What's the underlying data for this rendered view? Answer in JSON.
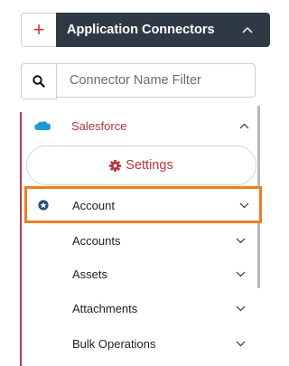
{
  "header": {
    "add_symbol": "+",
    "title": "Application Connectors",
    "collapse_icon": "chevron-up-icon"
  },
  "search": {
    "icon": "search-icon",
    "placeholder": "Connector Name Filter",
    "value": ""
  },
  "tree": {
    "connector": {
      "label": "Salesforce",
      "icon": "salesforce-cloud-icon",
      "expanded": true
    },
    "settings_button": {
      "label": "Settings",
      "icon": "gear-icon"
    },
    "selected_item": {
      "label": "Account",
      "icon": "entity-icon",
      "highlight_color": "#f07c22"
    },
    "sub_items": [
      {
        "label": "Accounts"
      },
      {
        "label": "Assets"
      },
      {
        "label": "Attachments"
      },
      {
        "label": "Bulk Operations"
      }
    ]
  },
  "colors": {
    "brand_red": "#b5343e",
    "header_bg": "#2d3a45",
    "tree_line": "#b83a48",
    "salesforce_blue": "#1d9ad6"
  }
}
